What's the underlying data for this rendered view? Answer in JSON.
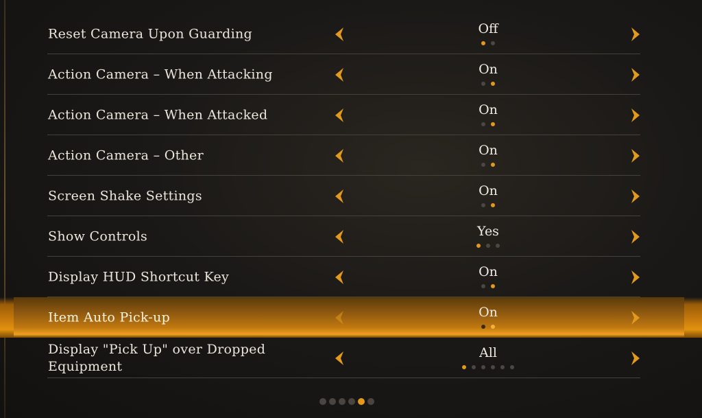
{
  "settings": [
    {
      "label": "Reset Camera Upon Guarding",
      "value": "Off",
      "options": 2,
      "selected_index": 0
    },
    {
      "label": "Action Camera – When Attacking",
      "value": "On",
      "options": 2,
      "selected_index": 1
    },
    {
      "label": "Action Camera – When Attacked",
      "value": "On",
      "options": 2,
      "selected_index": 1
    },
    {
      "label": "Action Camera – Other",
      "value": "On",
      "options": 2,
      "selected_index": 1
    },
    {
      "label": "Screen Shake Settings",
      "value": "On",
      "options": 2,
      "selected_index": 1
    },
    {
      "label": "Show Controls",
      "value": "Yes",
      "options": 3,
      "selected_index": 0
    },
    {
      "label": "Display HUD Shortcut Key",
      "value": "On",
      "options": 2,
      "selected_index": 1
    },
    {
      "label": "Item Auto Pick-up",
      "value": "On",
      "options": 2,
      "selected_index": 1,
      "highlighted": true
    },
    {
      "label": "Display \"Pick Up\" over Dropped Equipment",
      "value": "All",
      "options": 6,
      "selected_index": 0
    }
  ],
  "pagination": {
    "pages": 6,
    "current_index": 4
  },
  "icons": {
    "left_arrow": "chevron-left-icon",
    "right_arrow": "chevron-right-icon"
  },
  "colors": {
    "accent": "#e39a1c",
    "highlight": "#c77a0c",
    "background": "#1b1917"
  }
}
